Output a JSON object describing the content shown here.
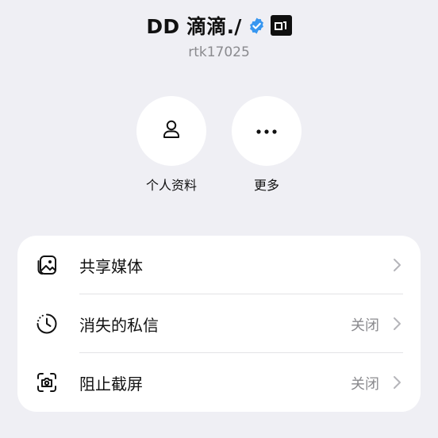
{
  "header": {
    "display_name": "DD 滴滴./",
    "username": "rtk17025",
    "verified_icon": "verified-check-icon",
    "badge_icon": "app-badge-icon"
  },
  "actions": [
    {
      "label": "个人资料",
      "icon": "person-icon"
    },
    {
      "label": "更多",
      "icon": "more-dots-icon"
    }
  ],
  "settings": [
    {
      "label": "共享媒体",
      "value": "",
      "icon": "shared-media-icon"
    },
    {
      "label": "消失的私信",
      "value": "关闭",
      "icon": "disappearing-timer-icon"
    },
    {
      "label": "阻止截屏",
      "value": "关闭",
      "icon": "screenshot-block-icon"
    }
  ],
  "colors": {
    "background": "#efeff4",
    "card": "#ffffff",
    "verified": "#3897f0",
    "secondary_text": "#8a8a8e"
  }
}
